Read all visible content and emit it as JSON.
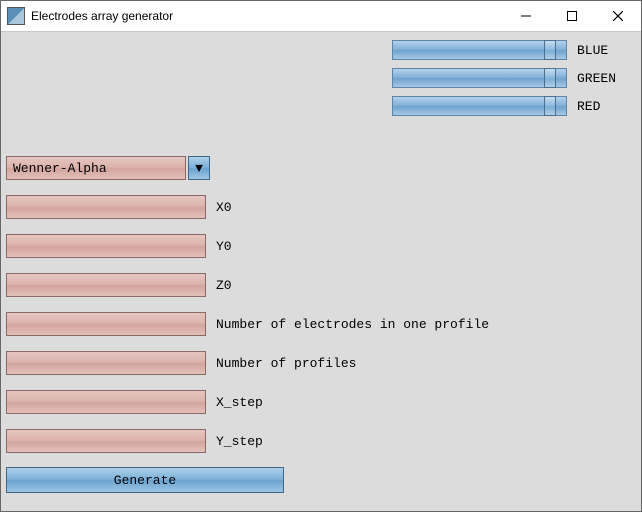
{
  "window": {
    "title": "Electrodes array generator"
  },
  "sliders": {
    "blue": {
      "label": "BLUE"
    },
    "green": {
      "label": "GREEN"
    },
    "red": {
      "label": "RED"
    }
  },
  "dropdown": {
    "selected": "Wenner-Alpha",
    "arrow_glyph": "▼"
  },
  "fields": {
    "x0": {
      "value": "",
      "label": "X0"
    },
    "y0": {
      "value": "",
      "label": "Y0"
    },
    "z0": {
      "value": "",
      "label": "Z0"
    },
    "n_elec": {
      "value": "",
      "label": "Number of electrodes in one profile"
    },
    "n_prof": {
      "value": "",
      "label": "Number of profiles"
    },
    "x_step": {
      "value": "",
      "label": "X_step"
    },
    "y_step": {
      "value": "",
      "label": "Y_step"
    }
  },
  "buttons": {
    "generate": "Generate"
  }
}
